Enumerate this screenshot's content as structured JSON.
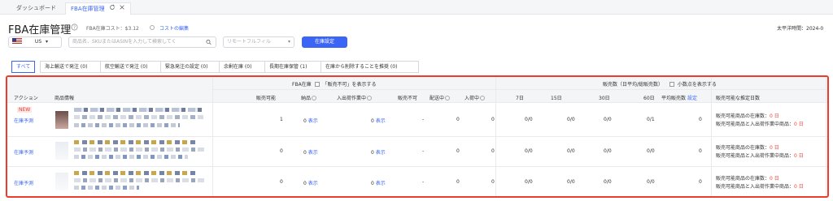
{
  "tabs": [
    {
      "label": "ダッシュボード"
    },
    {
      "label": "FBA在庫管理"
    }
  ],
  "header": {
    "title": "FBA在庫管理",
    "cost_label": "FBA在庫コスト：$3.12",
    "cost_edit": "コストの編集",
    "timezone": "太平洋時間：2024-0"
  },
  "toolbar": {
    "marketplace": "US",
    "search_placeholder": "商品名、SKUまたはASINを入力して検索してく",
    "filter_placeholder": "リモートフルフィル",
    "settings_button": "在庫設定"
  },
  "filters": [
    "すべて",
    "海上輸送で発注 (0)",
    "航空輸送で発注 (0)",
    "緊急発注の設定 (0)",
    "余剰在庫 (0)",
    "長期在庫保管 (1)",
    "在庫から削除することを推奨 (0)"
  ],
  "table": {
    "group_fba": "FBA在庫",
    "group_fba_option": "「販売不可」を表示する",
    "group_sales": "販売数（日平均/総販売数）",
    "group_sales_option": "小数点を表示する",
    "columns": {
      "action": "アクション",
      "product": "商品情報",
      "sellable": "販売可能",
      "inbound": "納品",
      "receiving": "入出荷作業中",
      "unsellable": "販売不可",
      "shipping": "配送中",
      "incoming": "入荷中",
      "d7": "7日",
      "d15": "15日",
      "d30": "30日",
      "d60": "60日",
      "avg": "平均販売数",
      "avg_setting": "設定",
      "days": "販売可能な推定日数"
    },
    "rows": [
      {
        "badge": "NEW",
        "action": "在庫予測",
        "sellable": "1",
        "inbound": "0",
        "inbound_link": "表示",
        "receiving": "0",
        "receiving_link": "表示",
        "unsellable": "-",
        "shipping": "0",
        "incoming": "0",
        "d7": "0/0",
        "d15": "0/0",
        "d30": "0/0",
        "d60": "0/1",
        "avg": "0",
        "days1_label": "販売可能商品の在庫数：",
        "days1_value": "0 日",
        "days2_label": "販売可能商品と入出荷作業中商品：",
        "days2_value": "0 日"
      },
      {
        "badge": "",
        "action": "在庫予測",
        "sellable": "0",
        "inbound": "0",
        "inbound_link": "表示",
        "receiving": "0",
        "receiving_link": "表示",
        "unsellable": "-",
        "shipping": "0",
        "incoming": "0",
        "d7": "0/0",
        "d15": "0/0",
        "d30": "0/0",
        "d60": "0/0",
        "avg": "0",
        "days1_label": "販売可能商品の在庫数：",
        "days1_value": "0 日",
        "days2_label": "販売可能商品と入出荷作業中商品：",
        "days2_value": "0 日"
      },
      {
        "badge": "",
        "action": "在庫予測",
        "sellable": "0",
        "inbound": "0",
        "inbound_link": "表示",
        "receiving": "0",
        "receiving_link": "表示",
        "unsellable": "-",
        "shipping": "0",
        "incoming": "0",
        "d7": "0/0",
        "d15": "0/0",
        "d30": "0/0",
        "d60": "0/0",
        "avg": "0",
        "days1_label": "販売可能商品の在庫数：",
        "days1_value": "0 日",
        "days2_label": "販売可能商品と入出荷作業中商品：",
        "days2_value": "0 日"
      }
    ]
  },
  "colors": {
    "accent": "#3b66f5",
    "highlight": "#ef3b2d",
    "danger": "#e5483a"
  }
}
